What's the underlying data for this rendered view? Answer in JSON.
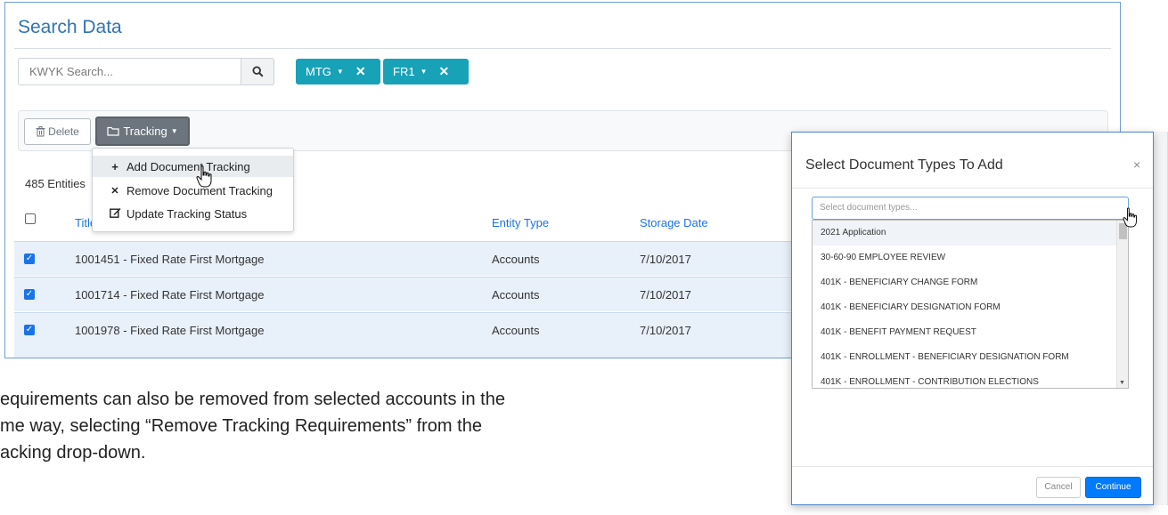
{
  "page": {
    "title": "Search Data",
    "search_placeholder": "KWYK Search...",
    "filters": [
      {
        "label": "MTG"
      },
      {
        "label": "FR1"
      }
    ]
  },
  "toolbar": {
    "delete_label": "Delete",
    "tracking_label": "Tracking"
  },
  "tracking_menu": {
    "items": [
      {
        "label": "Add Document Tracking",
        "icon": "plus-icon"
      },
      {
        "label": "Remove Document Tracking",
        "icon": "times-icon"
      },
      {
        "label": "Update Tracking Status",
        "icon": "edit-icon"
      }
    ]
  },
  "grid": {
    "count_label": "485 Entities",
    "columns": [
      "Title",
      "Entity Type",
      "Storage Date"
    ],
    "rows": [
      {
        "title": "1001451 - Fixed Rate First Mortgage",
        "entity_type": "Accounts",
        "storage_date": "7/10/2017",
        "checked": true
      },
      {
        "title": "1001714 - Fixed Rate First Mortgage",
        "entity_type": "Accounts",
        "storage_date": "7/10/2017",
        "checked": true
      },
      {
        "title": "1001978 - Fixed Rate First Mortgage",
        "entity_type": "Accounts",
        "storage_date": "7/10/2017",
        "checked": true
      }
    ]
  },
  "caption": {
    "lines": [
      "equirements can also be removed from selected accounts in the",
      "me way, selecting “Remove Tracking Requirements” from the",
      "acking drop-down."
    ]
  },
  "modal": {
    "title": "Select Document Types To Add",
    "close_glyph": "×",
    "select_placeholder": "Select document types...",
    "options": [
      "2021 Application",
      "30-60-90 EMPLOYEE REVIEW",
      "401K - BENEFICIARY CHANGE FORM",
      "401K - BENEFICIARY DESIGNATION FORM",
      "401K - BENEFIT PAYMENT REQUEST",
      "401K - ENROLLMENT - BENEFICIARY DESIGNATION FORM",
      "401K - ENROLLMENT - CONTRIBUTION ELECTIONS"
    ],
    "cancel_label": "Cancel",
    "continue_label": "Continue"
  },
  "colors": {
    "title_blue": "#2f73b5",
    "chip_teal": "#17a2b8",
    "link_blue": "#1a73e8",
    "row_selected": "#e8f0fa",
    "continue_blue": "#007bff"
  }
}
